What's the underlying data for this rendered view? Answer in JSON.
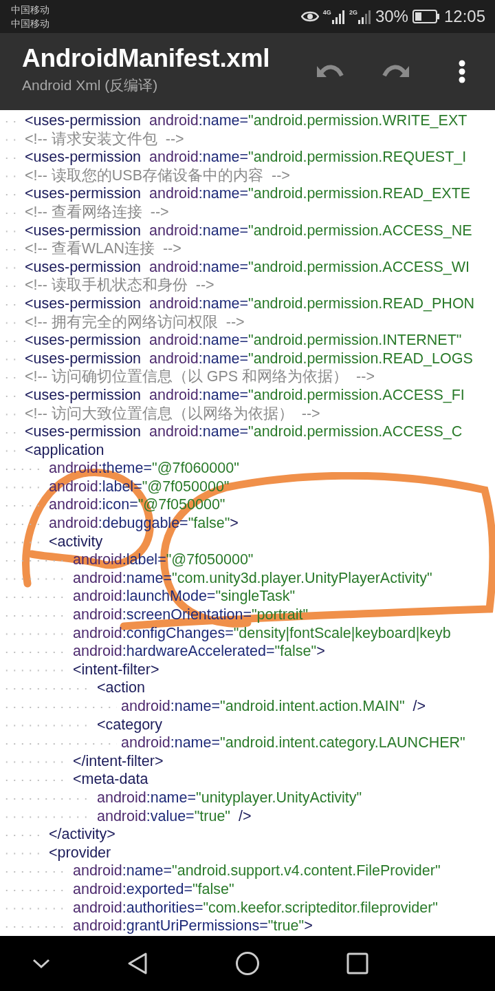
{
  "status_bar": {
    "carriers": [
      "中国移动",
      "中国移动"
    ],
    "networks": [
      "4G",
      "2G"
    ],
    "battery": "30%",
    "time": "12:05"
  },
  "toolbar": {
    "title": "AndroidManifest.xml",
    "subtitle": "Android Xml (反编译)",
    "actions": [
      {
        "kind": "undo",
        "disabled": true
      },
      {
        "kind": "redo",
        "disabled": true
      },
      {
        "kind": "menu",
        "disabled": false
      }
    ]
  },
  "code": {
    "lines": [
      {
        "parts": [
          {
            "kind": "tag",
            "text": "<uses-permission"
          },
          {
            "kind": "ns",
            "text": "  android"
          },
          {
            "kind": "attr",
            "text": ":name="
          },
          {
            "kind": "value",
            "text": "\"android.permission.WRITE_EXT"
          }
        ]
      },
      {
        "parts": [
          {
            "kind": "comment",
            "text": "<!-- 请求安装文件包  -->"
          }
        ]
      },
      {
        "parts": [
          {
            "kind": "tag",
            "text": "<uses-permission"
          },
          {
            "kind": "ns",
            "text": "  android"
          },
          {
            "kind": "attr",
            "text": ":name="
          },
          {
            "kind": "value",
            "text": "\"android.permission.REQUEST_I"
          }
        ]
      },
      {
        "parts": [
          {
            "kind": "comment",
            "text": "<!-- 读取您的USB存储设备中的内容  -->"
          }
        ]
      },
      {
        "parts": [
          {
            "kind": "tag",
            "text": "<uses-permission"
          },
          {
            "kind": "ns",
            "text": "  android"
          },
          {
            "kind": "attr",
            "text": ":name="
          },
          {
            "kind": "value",
            "text": "\"android.permission.READ_EXTE"
          }
        ]
      },
      {
        "parts": [
          {
            "kind": "comment",
            "text": "<!-- 查看网络连接  -->"
          }
        ]
      },
      {
        "parts": [
          {
            "kind": "tag",
            "text": "<uses-permission"
          },
          {
            "kind": "ns",
            "text": "  android"
          },
          {
            "kind": "attr",
            "text": ":name="
          },
          {
            "kind": "value",
            "text": "\"android.permission.ACCESS_NE"
          }
        ]
      },
      {
        "parts": [
          {
            "kind": "comment",
            "text": "<!-- 查看WLAN连接  -->"
          }
        ]
      },
      {
        "parts": [
          {
            "kind": "tag",
            "text": "<uses-permission"
          },
          {
            "kind": "ns",
            "text": "  android"
          },
          {
            "kind": "attr",
            "text": ":name="
          },
          {
            "kind": "value",
            "text": "\"android.permission.ACCESS_WI"
          }
        ]
      },
      {
        "parts": [
          {
            "kind": "comment",
            "text": "<!-- 读取手机状态和身份  -->"
          }
        ]
      },
      {
        "parts": [
          {
            "kind": "tag",
            "text": "<uses-permission"
          },
          {
            "kind": "ns",
            "text": "  android"
          },
          {
            "kind": "attr",
            "text": ":name="
          },
          {
            "kind": "value",
            "text": "\"android.permission.READ_PHON"
          }
        ]
      },
      {
        "parts": [
          {
            "kind": "comment",
            "text": "<!-- 拥有完全的网络访问权限  -->"
          }
        ]
      },
      {
        "parts": [
          {
            "kind": "tag",
            "text": "<uses-permission"
          },
          {
            "kind": "ns",
            "text": "  android"
          },
          {
            "kind": "attr",
            "text": ":name="
          },
          {
            "kind": "value",
            "text": "\"android.permission.INTERNET\""
          }
        ]
      },
      {
        "parts": [
          {
            "kind": "tag",
            "text": "<uses-permission"
          },
          {
            "kind": "ns",
            "text": "  android"
          },
          {
            "kind": "attr",
            "text": ":name="
          },
          {
            "kind": "value",
            "text": "\"android.permission.READ_LOGS"
          }
        ]
      },
      {
        "parts": [
          {
            "kind": "comment",
            "text": "<!-- 访问确切位置信息（以 GPS 和网络为依据）  -->"
          }
        ]
      },
      {
        "parts": [
          {
            "kind": "tag",
            "text": "<uses-permission"
          },
          {
            "kind": "ns",
            "text": "  android"
          },
          {
            "kind": "attr",
            "text": ":name="
          },
          {
            "kind": "value",
            "text": "\"android.permission.ACCESS_FI"
          }
        ]
      },
      {
        "parts": [
          {
            "kind": "comment",
            "text": "<!-- 访问大致位置信息（以网络为依据）  -->"
          }
        ]
      },
      {
        "parts": [
          {
            "kind": "tag",
            "text": "<uses-permission"
          },
          {
            "kind": "ns",
            "text": "  android"
          },
          {
            "kind": "attr",
            "text": ":name="
          },
          {
            "kind": "value",
            "text": "\"android.permission.ACCESS_C"
          }
        ]
      },
      {
        "parts": [
          {
            "kind": "tag",
            "text": "<application"
          }
        ],
        "children": [
          {
            "parts": [
              {
                "kind": "ns",
                "text": "android"
              },
              {
                "kind": "attr",
                "text": ":theme="
              },
              {
                "kind": "value",
                "text": "\"@7f060000\""
              }
            ]
          },
          {
            "parts": [
              {
                "kind": "ns",
                "text": "android"
              },
              {
                "kind": "attr",
                "text": ":label="
              },
              {
                "kind": "value",
                "text": "\"@7f050000\""
              }
            ]
          },
          {
            "parts": [
              {
                "kind": "ns",
                "text": "android"
              },
              {
                "kind": "attr",
                "text": ":icon="
              },
              {
                "kind": "value",
                "text": "\"@7f050000\""
              }
            ]
          },
          {
            "parts": [
              {
                "kind": "ns",
                "text": "android"
              },
              {
                "kind": "attr",
                "text": ":debuggable="
              },
              {
                "kind": "value",
                "text": "\"false\""
              },
              {
                "kind": "tag",
                "text": ">"
              }
            ]
          },
          {
            "parts": [
              {
                "kind": "tag",
                "text": "<activity"
              }
            ],
            "children": [
              {
                "parts": [
                  {
                    "kind": "ns",
                    "text": "android"
                  },
                  {
                    "kind": "attr",
                    "text": ":label="
                  },
                  {
                    "kind": "value",
                    "text": "\"@7f050000\""
                  }
                ]
              },
              {
                "parts": [
                  {
                    "kind": "ns",
                    "text": "android"
                  },
                  {
                    "kind": "attr",
                    "text": ":name="
                  },
                  {
                    "kind": "value",
                    "text": "\"com.unity3d.player.UnityPlayerActivity\""
                  }
                ]
              },
              {
                "parts": [
                  {
                    "kind": "ns",
                    "text": "android"
                  },
                  {
                    "kind": "attr",
                    "text": ":launchMode="
                  },
                  {
                    "kind": "value",
                    "text": "\"singleTask\""
                  }
                ]
              },
              {
                "parts": [
                  {
                    "kind": "ns",
                    "text": "android"
                  },
                  {
                    "kind": "attr",
                    "text": ":screenOrientation="
                  },
                  {
                    "kind": "value",
                    "text": "\"portrait\""
                  }
                ]
              },
              {
                "parts": [
                  {
                    "kind": "ns",
                    "text": "android"
                  },
                  {
                    "kind": "attr",
                    "text": ":configChanges="
                  },
                  {
                    "kind": "value",
                    "text": "\"density|fontScale|keyboard|keyb"
                  }
                ]
              },
              {
                "parts": [
                  {
                    "kind": "ns",
                    "text": "android"
                  },
                  {
                    "kind": "attr",
                    "text": ":hardwareAccelerated="
                  },
                  {
                    "kind": "value",
                    "text": "\"false\""
                  },
                  {
                    "kind": "tag",
                    "text": ">"
                  }
                ]
              },
              {
                "parts": [
                  {
                    "kind": "tag",
                    "text": "<intent-filter>"
                  }
                ],
                "children": [
                  {
                    "parts": [
                      {
                        "kind": "tag",
                        "text": "<action"
                      }
                    ],
                    "children": [
                      {
                        "parts": [
                          {
                            "kind": "ns",
                            "text": "android"
                          },
                          {
                            "kind": "attr",
                            "text": ":name="
                          },
                          {
                            "kind": "value",
                            "text": "\"android.intent.action.MAIN\""
                          },
                          {
                            "kind": "tag",
                            "text": "  />"
                          }
                        ]
                      }
                    ]
                  },
                  {
                    "parts": [
                      {
                        "kind": "tag",
                        "text": "<category"
                      }
                    ],
                    "children": [
                      {
                        "parts": [
                          {
                            "kind": "ns",
                            "text": "android"
                          },
                          {
                            "kind": "attr",
                            "text": ":name="
                          },
                          {
                            "kind": "value",
                            "text": "\"android.intent.category.LAUNCHER\""
                          }
                        ]
                      }
                    ]
                  }
                ]
              },
              {
                "parts": [
                  {
                    "kind": "tag",
                    "text": "</intent-filter>"
                  }
                ]
              },
              {
                "parts": [
                  {
                    "kind": "tag",
                    "text": "<meta-data"
                  }
                ],
                "children": [
                  {
                    "parts": [
                      {
                        "kind": "ns",
                        "text": "android"
                      },
                      {
                        "kind": "attr",
                        "text": ":name="
                      },
                      {
                        "kind": "value",
                        "text": "\"unityplayer.UnityActivity\""
                      }
                    ]
                  },
                  {
                    "parts": [
                      {
                        "kind": "ns",
                        "text": "android"
                      },
                      {
                        "kind": "attr",
                        "text": ":value="
                      },
                      {
                        "kind": "value",
                        "text": "\"true\""
                      },
                      {
                        "kind": "tag",
                        "text": "  />"
                      }
                    ]
                  }
                ]
              }
            ]
          },
          {
            "parts": [
              {
                "kind": "tag",
                "text": "</activity>"
              }
            ]
          },
          {
            "parts": [
              {
                "kind": "tag",
                "text": "<provider"
              }
            ],
            "children": [
              {
                "parts": [
                  {
                    "kind": "ns",
                    "text": "android"
                  },
                  {
                    "kind": "attr",
                    "text": ":name="
                  },
                  {
                    "kind": "value",
                    "text": "\"android.support.v4.content.FileProvider\""
                  }
                ]
              },
              {
                "parts": [
                  {
                    "kind": "ns",
                    "text": "android"
                  },
                  {
                    "kind": "attr",
                    "text": ":exported="
                  },
                  {
                    "kind": "value",
                    "text": "\"false\""
                  }
                ]
              },
              {
                "parts": [
                  {
                    "kind": "ns",
                    "text": "android"
                  },
                  {
                    "kind": "attr",
                    "text": ":authorities="
                  },
                  {
                    "kind": "value",
                    "text": "\"com.keefor.scripteditor.fileprovider\""
                  }
                ]
              },
              {
                "parts": [
                  {
                    "kind": "ns",
                    "text": "android"
                  },
                  {
                    "kind": "attr",
                    "text": ":grantUriPermissions="
                  },
                  {
                    "kind": "value",
                    "text": "\"true\""
                  },
                  {
                    "kind": "tag",
                    "text": ">"
                  }
                ]
              }
            ]
          }
        ]
      }
    ]
  }
}
